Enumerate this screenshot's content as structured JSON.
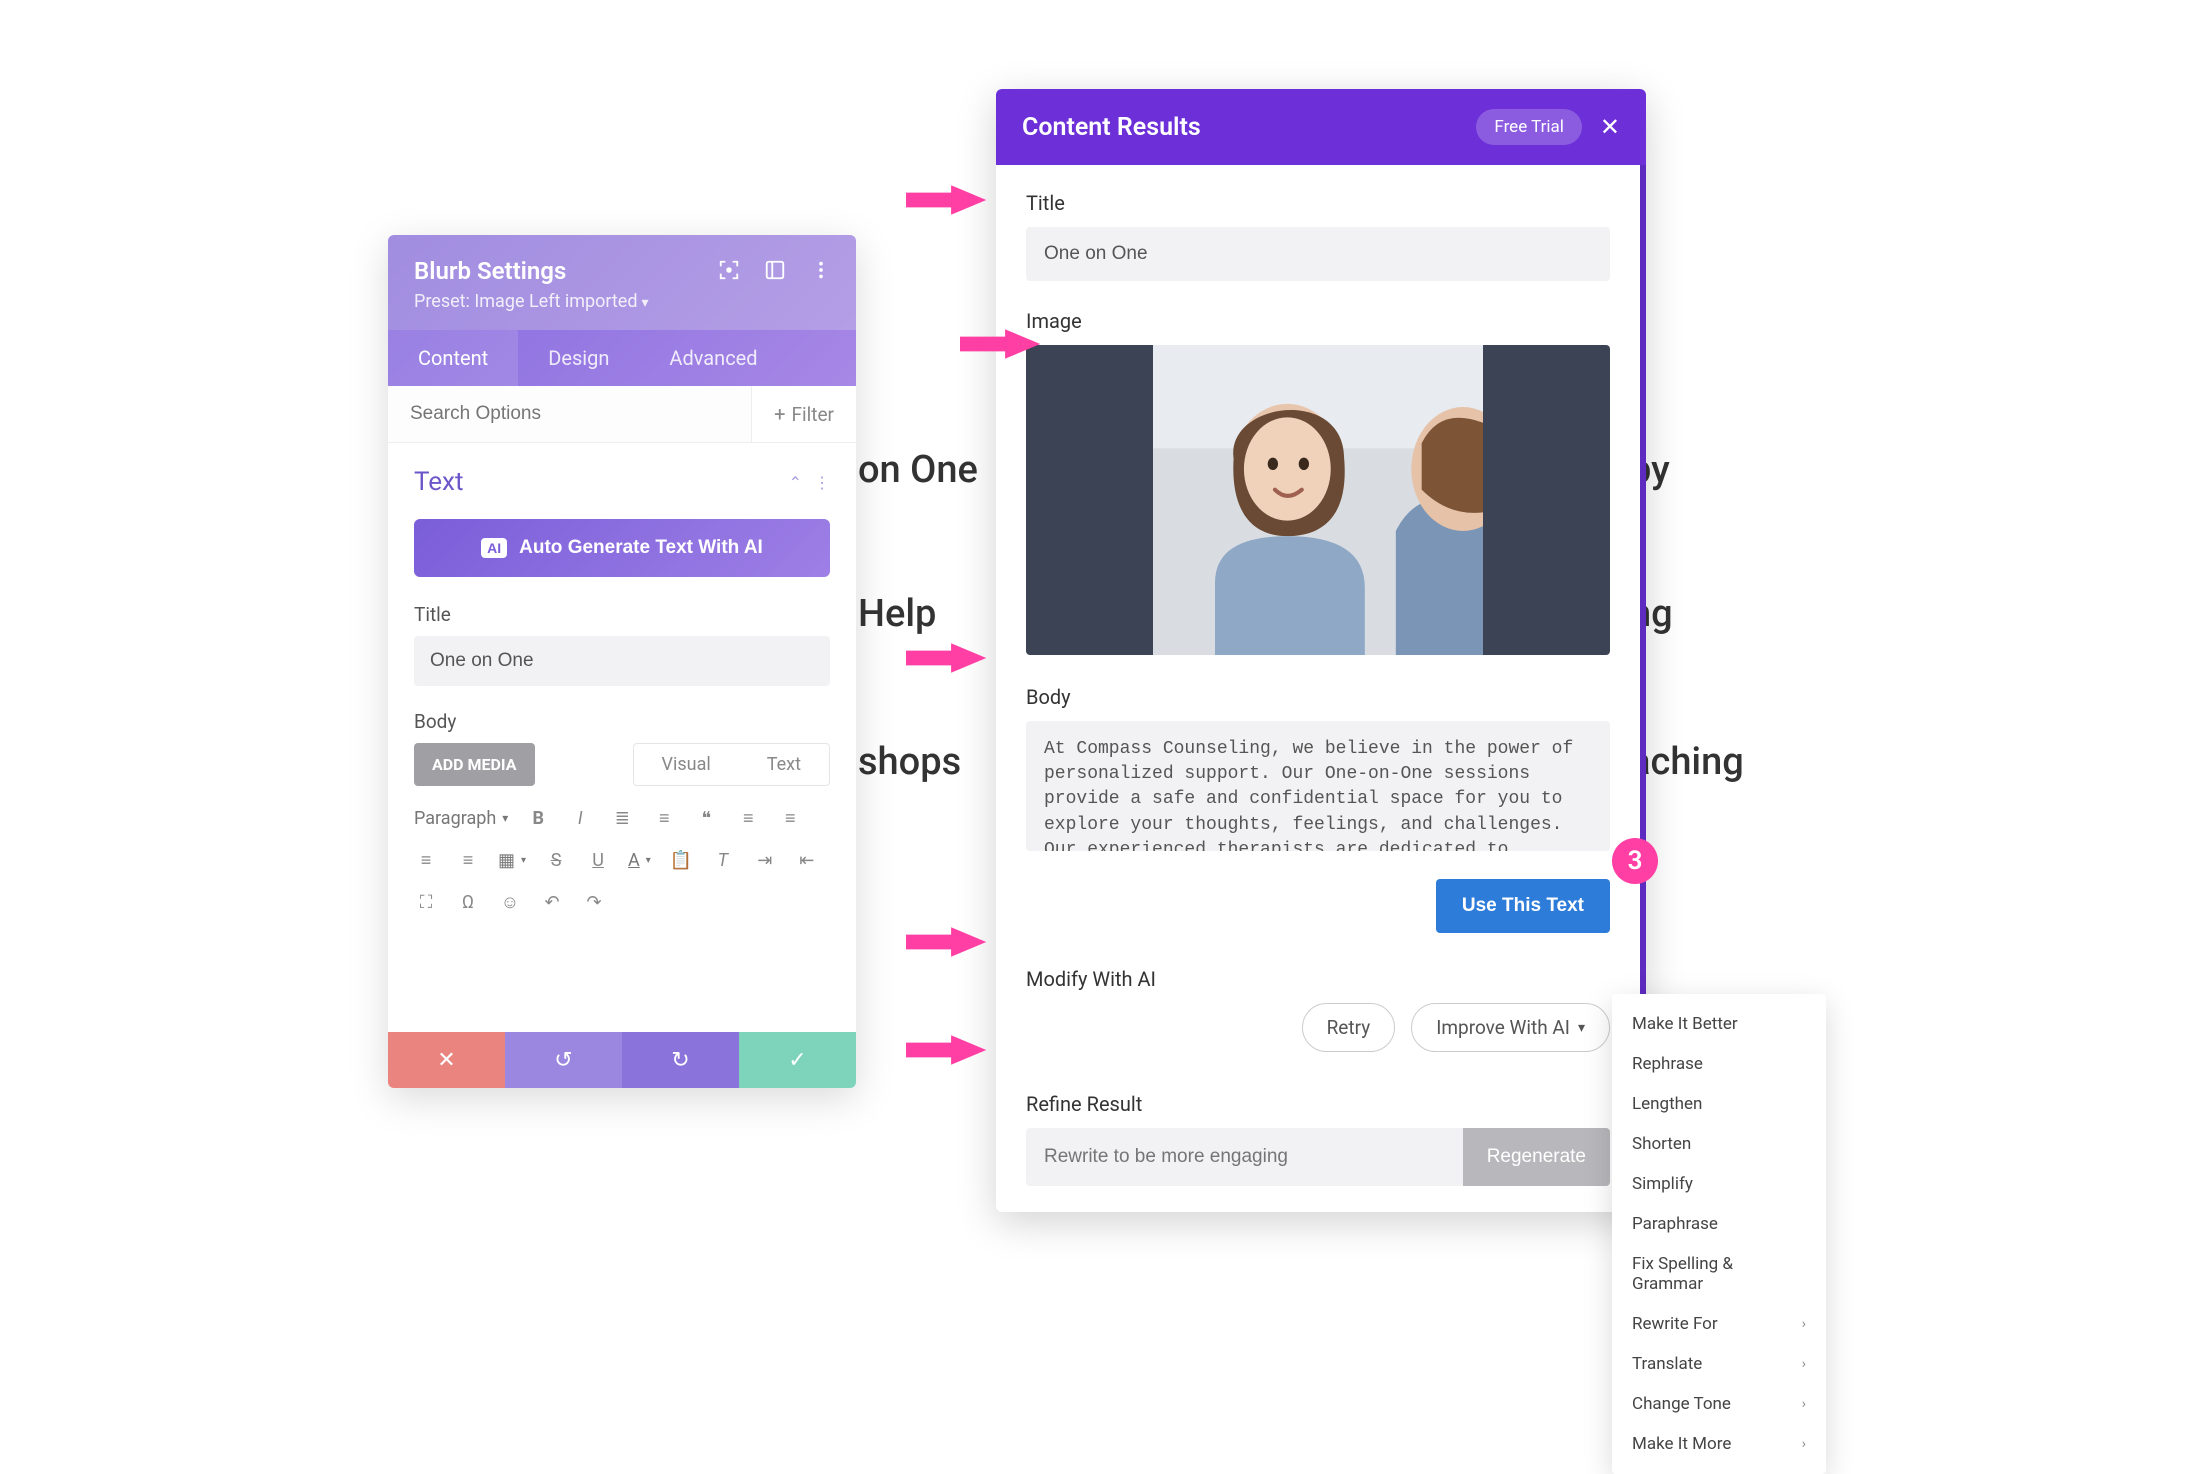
{
  "bg_texts": {
    "on_one": "on One",
    "help": "Help",
    "shops": "shops",
    "right_a": "py",
    "right_b": "ng",
    "right_c": "aching"
  },
  "blurb": {
    "title": "Blurb Settings",
    "preset": "Preset: Image Left imported",
    "tabs": {
      "content": "Content",
      "design": "Design",
      "advanced": "Advanced"
    },
    "search_placeholder": "Search Options",
    "filter_label": "Filter",
    "section_title": "Text",
    "ai_button": "Auto Generate Text With AI",
    "ai_badge": "AI",
    "title_label": "Title",
    "title_value": "One on One",
    "body_label": "Body",
    "add_media": "ADD MEDIA",
    "visual_tab": "Visual",
    "text_tab": "Text",
    "paragraph_selector": "Paragraph"
  },
  "results": {
    "header_title": "Content Results",
    "free_trial": "Free Trial",
    "title_label": "Title",
    "title_value": "One on One",
    "image_label": "Image",
    "body_label": "Body",
    "body_value": "At Compass Counseling, we believe in the power of personalized support. Our One-on-One sessions provide a safe and confidential space for you to explore your thoughts, feelings, and challenges. Our experienced therapists are dedicated to helping you navigate through life's ups and downs, empowering you to discover your true potential.",
    "use_text": "Use This Text",
    "modify_label": "Modify With AI",
    "retry": "Retry",
    "improve": "Improve With AI",
    "refine_label": "Refine Result",
    "refine_placeholder": "Rewrite to be more engaging",
    "regenerate": "Regenerate"
  },
  "dropdown": {
    "items": [
      {
        "label": "Make It Better",
        "sub": false
      },
      {
        "label": "Rephrase",
        "sub": false
      },
      {
        "label": "Lengthen",
        "sub": false
      },
      {
        "label": "Shorten",
        "sub": false
      },
      {
        "label": "Simplify",
        "sub": false
      },
      {
        "label": "Paraphrase",
        "sub": false
      },
      {
        "label": "Fix Spelling & Grammar",
        "sub": false
      },
      {
        "label": "Rewrite For",
        "sub": true
      },
      {
        "label": "Translate",
        "sub": true
      },
      {
        "label": "Change Tone",
        "sub": true
      },
      {
        "label": "Make It More",
        "sub": true
      }
    ]
  },
  "badge": "3"
}
